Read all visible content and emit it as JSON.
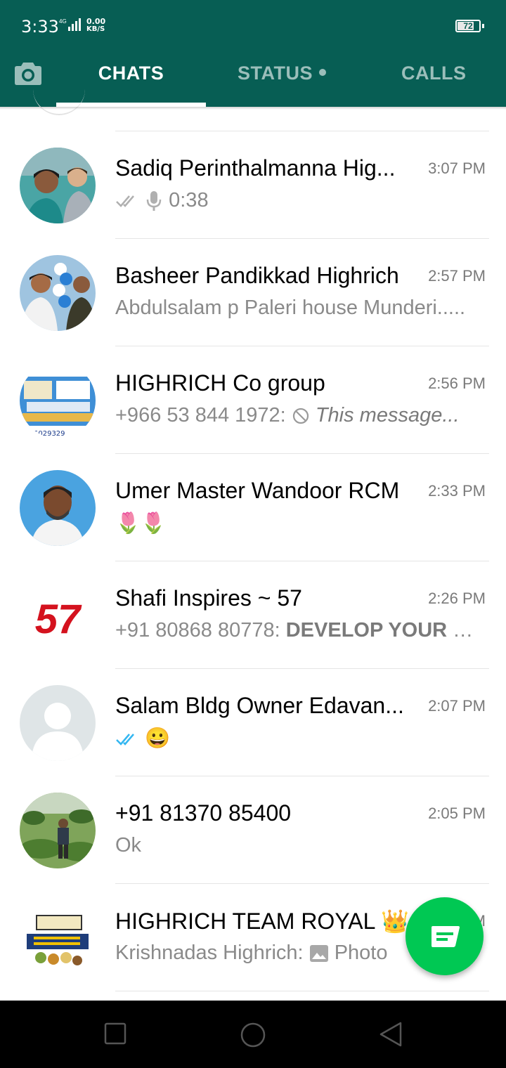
{
  "status_bar": {
    "time": "3:33",
    "network": "4G",
    "speed_value": "0.00",
    "speed_unit": "KB/S",
    "battery": "72"
  },
  "tabs": {
    "chats": "CHATS",
    "status": "STATUS",
    "calls": "CALLS",
    "active": "chats"
  },
  "chats": [
    {
      "name": "Sadiq Perinthalmanna Hig...",
      "time": "3:07 PM",
      "preview": "0:38",
      "icons": [
        "double-tick-icon",
        "microphone-icon"
      ]
    },
    {
      "name": "Basheer Pandikkad Highrich",
      "time": "2:57 PM",
      "preview": "Abdulsalam p Paleri house Munderi.....",
      "icons": []
    },
    {
      "name": "HIGHRICH  Co group",
      "time": "2:56 PM",
      "preview_sender": "+966 53 844 1972:",
      "preview": "This message...",
      "icons": [
        "deleted-message-icon"
      ]
    },
    {
      "name": "Umer Master Wandoor RCM",
      "time": "2:33 PM",
      "preview": "🌷🌷",
      "icons": []
    },
    {
      "name": "Shafi Inspires ~ 57",
      "time": "2:26 PM",
      "preview_sender": "+91 80868 80778:",
      "preview": "DEVELOP YOUR S...",
      "avatar_text": "57",
      "icons": []
    },
    {
      "name": "Salam Bldg Owner Edavan...",
      "time": "2:07 PM",
      "preview": "😀",
      "icons": [
        "double-tick-read-icon"
      ]
    },
    {
      "name": "+91 81370 85400",
      "time": "2:05 PM",
      "preview": "Ok",
      "icons": []
    },
    {
      "name": "HIGHRICH TEAM ROYAL 👑",
      "time": "PM",
      "preview_sender": "Krishnadas Highrich:",
      "preview": "Photo",
      "icons": [
        "photo-icon"
      ]
    }
  ],
  "colors": {
    "header": "#075e54",
    "fab": "#00c853",
    "read_tick": "#34b7f1"
  }
}
